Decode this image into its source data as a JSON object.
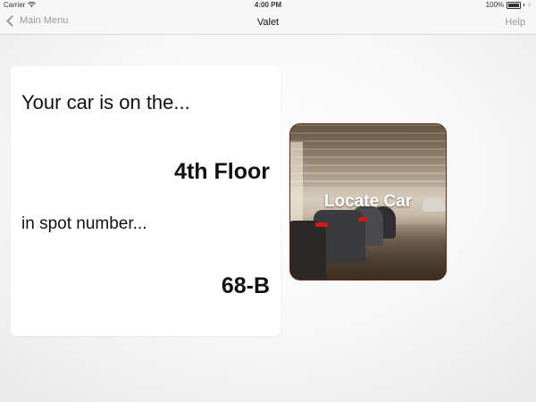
{
  "status_bar": {
    "carrier": "Carrier",
    "time": "4:00 PM",
    "battery": "100%"
  },
  "nav": {
    "back_label": "Main Menu",
    "title": "Valet",
    "help_label": "Help"
  },
  "info": {
    "floor_prompt": "Your car is on the...",
    "floor_value": "4th Floor",
    "spot_prompt": "in spot number...",
    "spot_value": "68-B"
  },
  "locate": {
    "label": "Locate Car"
  },
  "icons": {
    "wifi": "wifi-icon",
    "battery": "battery-icon",
    "charging": "charging-bolt-icon",
    "back": "chevron-left-icon"
  },
  "colors": {
    "nav_inactive": "#999999",
    "card_background": "#ffffff",
    "tile_border": "#6a2a12"
  }
}
